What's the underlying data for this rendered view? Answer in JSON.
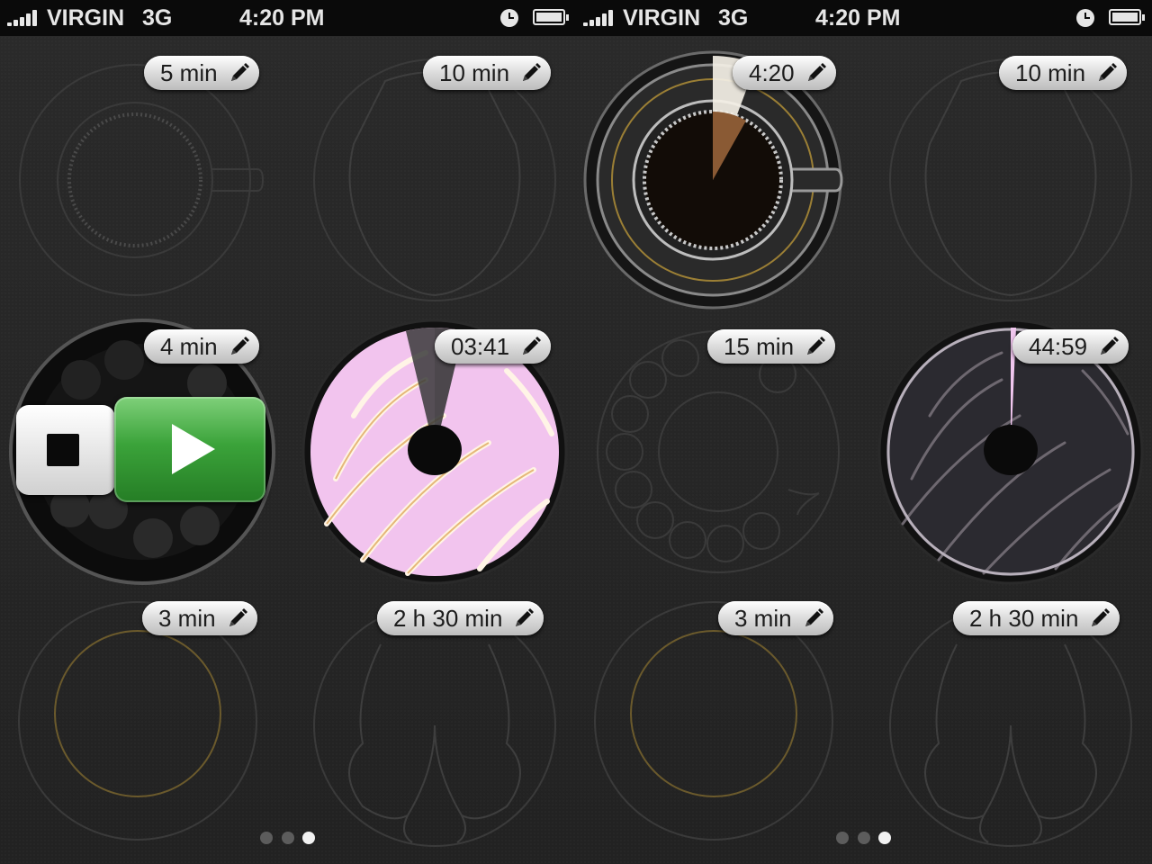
{
  "status_bar": {
    "carrier": "VIRGIN",
    "network": "3G",
    "time": "4:20 PM"
  },
  "screens": [
    {
      "timers": [
        {
          "label": "5 min",
          "art": "coffee-cup-icon",
          "state": "idle"
        },
        {
          "label": "10 min",
          "art": "face-silhouette-icon",
          "state": "idle"
        },
        {
          "label": "4 min",
          "art": "rotary-dial-icon",
          "state": "controls"
        },
        {
          "label": "03:41",
          "art": "donut-icon",
          "state": "running"
        },
        {
          "label": "3 min",
          "art": "plate-icon",
          "state": "idle"
        },
        {
          "label": "2 h 30 min",
          "art": "roast-chicken-icon",
          "state": "idle"
        }
      ],
      "page_dots": {
        "count": 3,
        "active": 3
      }
    },
    {
      "timers": [
        {
          "label": "4:20",
          "art": "coffee-cup-icon",
          "state": "running"
        },
        {
          "label": "10 min",
          "art": "face-silhouette-icon",
          "state": "idle"
        },
        {
          "label": "15 min",
          "art": "rotary-dial-icon",
          "state": "idle"
        },
        {
          "label": "44:59",
          "art": "donut-icon",
          "state": "running"
        },
        {
          "label": "3 min",
          "art": "plate-icon",
          "state": "idle"
        },
        {
          "label": "2 h 30 min",
          "art": "roast-chicken-icon",
          "state": "idle"
        }
      ],
      "page_dots": {
        "count": 3,
        "active": 3
      }
    }
  ],
  "controls": {
    "stop": "stop-icon",
    "play": "play-icon"
  },
  "colors": {
    "play_green": "#3ba33a",
    "donut_pink": "#f3c6ee",
    "coffee_gold": "#b8963a"
  }
}
